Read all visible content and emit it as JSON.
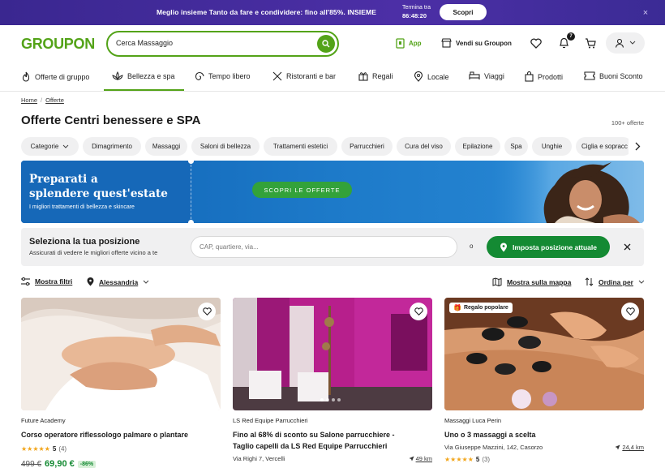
{
  "promo": {
    "text": "Meglio insieme Tanto da fare e condividere: fino all'85%. INSIEME",
    "timer_label": "Termina tra",
    "timer_value": "86:48:20",
    "button": "Scopri",
    "close": "×"
  },
  "header": {
    "logo": "GROUPON",
    "search_value": "Cerca Massaggio",
    "app_label": "App",
    "sell_label": "Vendi su Groupon",
    "notifications_count": "7"
  },
  "nav": {
    "items": [
      {
        "label": "Offerte di gruppo",
        "icon": "flame-icon"
      },
      {
        "label": "Bellezza e spa",
        "icon": "lotus-icon"
      },
      {
        "label": "Tempo libero",
        "icon": "spiral-icon"
      },
      {
        "label": "Ristoranti e bar",
        "icon": "cutlery-icon"
      },
      {
        "label": "Regali",
        "icon": "gift-icon"
      },
      {
        "label": "Locale",
        "icon": "location-icon"
      },
      {
        "label": "Viaggi",
        "icon": "bed-icon"
      },
      {
        "label": "Prodotti",
        "icon": "bag-icon"
      },
      {
        "label": "Buoni Sconto",
        "icon": "coupon-icon"
      }
    ]
  },
  "breadcrumb": {
    "home": "Home",
    "sep": "/",
    "current": "Offerte"
  },
  "page": {
    "title": "Offerte Centri benessere e SPA",
    "count": "100+ offerte"
  },
  "chips": [
    "Categorie",
    "Dimagrimento",
    "Massaggi",
    "Saloni di bellezza",
    "Trattamenti estetici",
    "Parrucchieri",
    "Cura del viso",
    "Epilazione",
    "Spa",
    "Unghie",
    "Ciglia e sopracc"
  ],
  "hero": {
    "title_line1": "Preparati a",
    "title_line2": "splendere quest'estate",
    "subtitle": "I migliori trattamenti di bellezza e skincare",
    "cta": "SCOPRI LE OFFERTE"
  },
  "location": {
    "title": "Seleziona la tua posizione",
    "subtitle": "Assicurati di vedere le migliori offerte vicino a te",
    "placeholder": "CAP, quartiere, via...",
    "or": "o",
    "button": "Imposta posizione attuale"
  },
  "filters": {
    "show_filters": "Mostra filtri",
    "city": "Alessandria",
    "show_map": "Mostra sulla mappa",
    "sort": "Ordina per"
  },
  "cards": [
    {
      "merchant": "Future Academy",
      "title": "Corso operatore riflessologo palmare o plantare",
      "rating": "5",
      "reviews": "(4)",
      "old_price": "499 €",
      "new_price": "69,90 €",
      "discount": "-86%"
    },
    {
      "merchant": "LS Red Equipe Parrucchieri",
      "title_line1": "Fino al 68% di sconto su Salone parrucchiere -",
      "title_line2": "Taglio capelli da LS Red Equipe Parrucchieri",
      "address": "Via Righi 7, Vercelli",
      "distance": "49 km"
    },
    {
      "badge": "Regalo popolare",
      "merchant": "Massaggi Luca Perin",
      "title": "Uno o 3 massaggi a scelta",
      "address": "Via Giuseppe Mazzini, 142, Casorzo",
      "distance": "24,4 km",
      "rating": "5",
      "reviews": "(3)"
    }
  ],
  "colors": {
    "brand_green": "#53a318",
    "promo_purple": "#4c2fa6",
    "cta_green": "#148a33",
    "star": "#f2a51a"
  }
}
